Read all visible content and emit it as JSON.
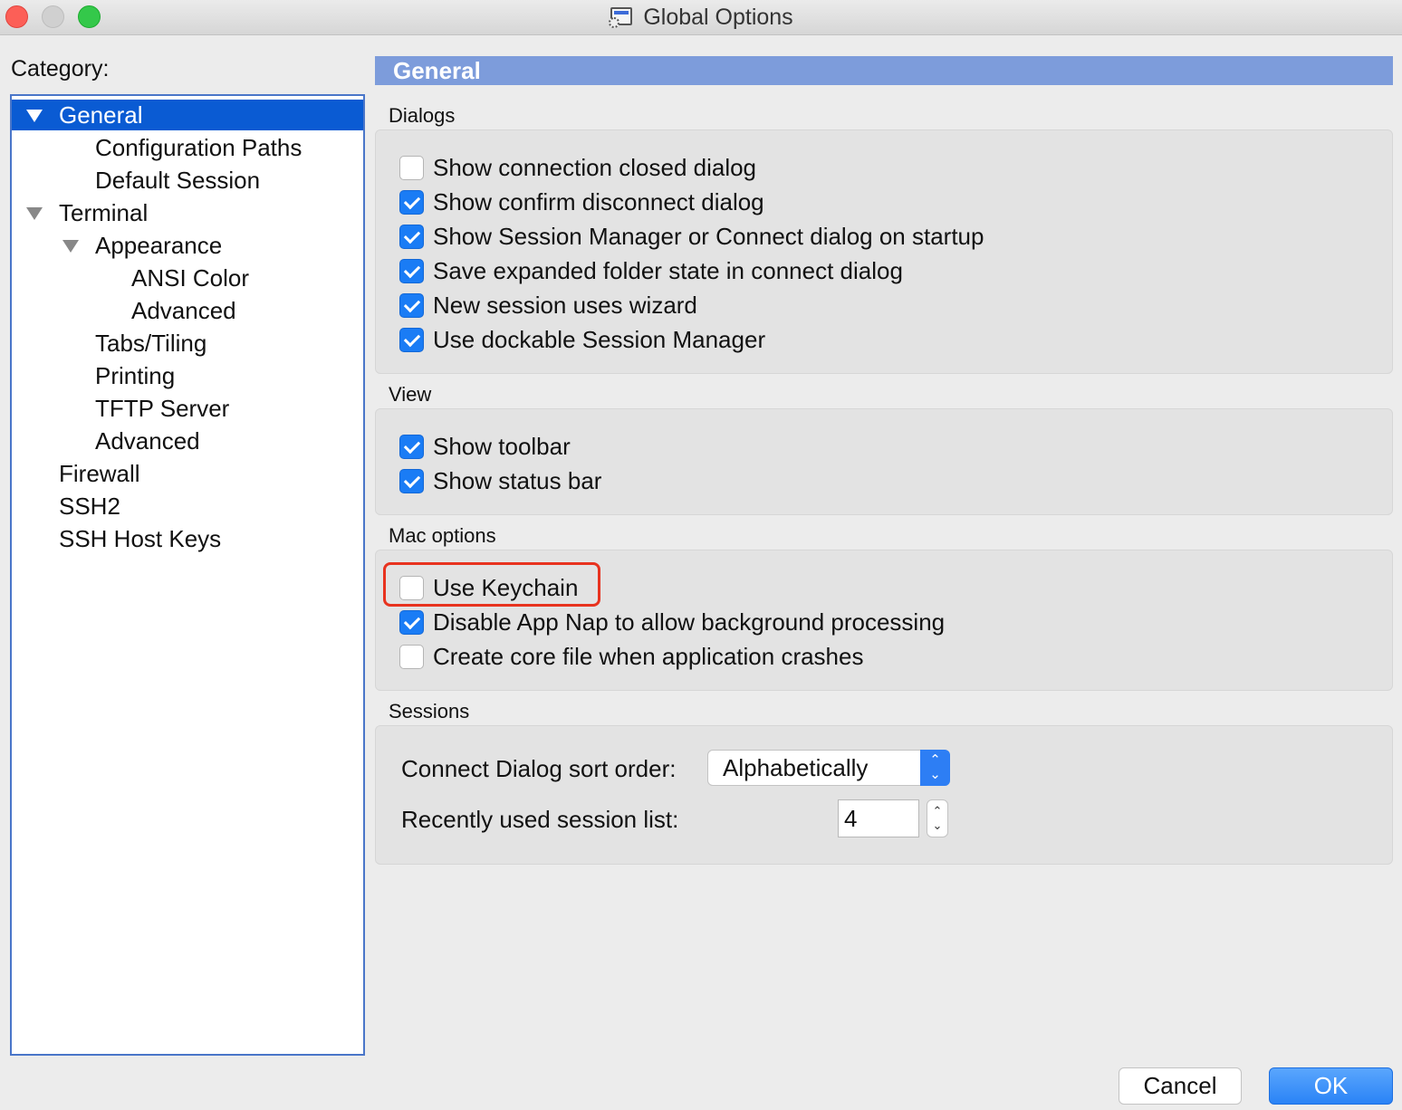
{
  "window": {
    "title": "Global Options",
    "icon": "app-options-icon",
    "controls": [
      "close",
      "minimize",
      "zoom"
    ]
  },
  "category": {
    "label": "Category:",
    "items": [
      {
        "label": "General",
        "level": 0,
        "expanded": true,
        "selected": true
      },
      {
        "label": "Configuration Paths",
        "level": 1
      },
      {
        "label": "Default Session",
        "level": 1
      },
      {
        "label": "Terminal",
        "level": 0,
        "expanded": true
      },
      {
        "label": "Appearance",
        "level": 1,
        "expanded": true
      },
      {
        "label": "ANSI Color",
        "level": 2
      },
      {
        "label": "Advanced",
        "level": 2
      },
      {
        "label": "Tabs/Tiling",
        "level": 1
      },
      {
        "label": "Printing",
        "level": 1
      },
      {
        "label": "TFTP Server",
        "level": 1
      },
      {
        "label": "Advanced",
        "level": 1
      },
      {
        "label": "Firewall",
        "level": 0
      },
      {
        "label": "SSH2",
        "level": 0
      },
      {
        "label": "SSH Host Keys",
        "level": 0
      }
    ]
  },
  "panel": {
    "title": "General",
    "dialogs": {
      "title": "Dialogs",
      "options": [
        {
          "label": "Show connection closed dialog",
          "checked": false
        },
        {
          "label": "Show confirm disconnect dialog",
          "checked": true
        },
        {
          "label": "Show Session Manager or Connect dialog on startup",
          "checked": true
        },
        {
          "label": "Save expanded folder state in connect dialog",
          "checked": true
        },
        {
          "label": "New session uses wizard",
          "checked": true
        },
        {
          "label": "Use dockable Session Manager",
          "checked": true
        }
      ]
    },
    "view": {
      "title": "View",
      "options": [
        {
          "label": "Show toolbar",
          "checked": true
        },
        {
          "label": "Show status bar",
          "checked": true
        }
      ]
    },
    "mac": {
      "title": "Mac options",
      "options": [
        {
          "label": "Use Keychain",
          "checked": false
        },
        {
          "label": "Disable App Nap to allow background processing",
          "checked": true
        },
        {
          "label": "Create core file when application crashes",
          "checked": false
        }
      ]
    },
    "sessions": {
      "title": "Sessions",
      "sort_label": "Connect Dialog sort order:",
      "sort_value": "Alphabetically",
      "recent_label": "Recently used session list:",
      "recent_value": "4"
    }
  },
  "buttons": {
    "cancel": "Cancel",
    "ok": "OK"
  },
  "colors": {
    "accent": "#0a5bd3",
    "header": "#7d9cdb",
    "highlight": "#e8331f",
    "ok_button": "#2a83f6"
  }
}
